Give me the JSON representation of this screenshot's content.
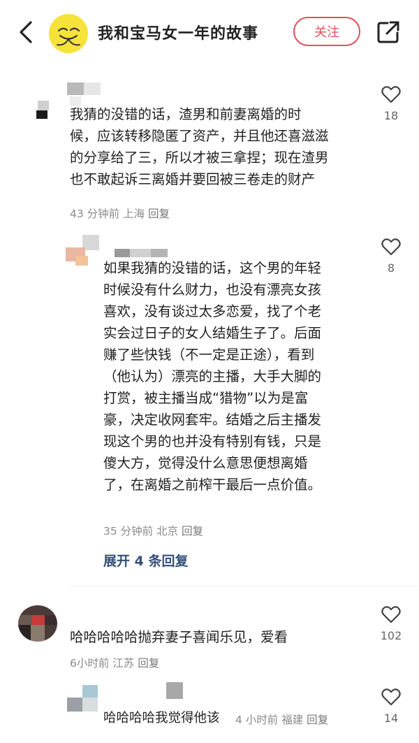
{
  "header": {
    "title": "我和宝马女一年的故事",
    "follow_label": "关注"
  },
  "comments": [
    {
      "lines": [
        "我猜的没错的话，渣男和前妻离婚的时",
        "候，应该转移隐匿了资产，并且他还喜滋滋",
        "的分享给了三，所以才被三拿捏；现在渣男",
        "也不敢起诉三离婚并要回被三卷走的财产"
      ],
      "meta": "43 分钟前 上海",
      "reply": "回复",
      "likes": "18"
    },
    {
      "lines": [
        "如果我猜的没错的话，这个男的年轻",
        "时候没有什么财力，也没有漂亮女孩",
        "喜欢，没有谈过太多恋爱，找了个老",
        "实会过日子的女人结婚生子了。后面",
        "赚了些快钱（不一定是正途），看到",
        "（他认为）漂亮的主播，大手大脚的",
        "打赏，被主播当成“猎物”以为是富",
        "豪，决定收网套牢。结婚之后主播发",
        "现这个男的也并没有特别有钱，只是",
        "傻大方，觉得没什么意思便想离婚",
        "了，在离婚之前榨干最后一点价值。"
      ],
      "meta": "35 分钟前 北京",
      "reply": "回复",
      "likes": "8",
      "expand": "展开 4 条回复"
    },
    {
      "text": "哈哈哈哈哈抛弃妻子喜闻乐见，爱看",
      "meta": "6小时前 江苏",
      "reply": "回复",
      "likes": "102"
    },
    {
      "text": "哈哈哈哈我觉得他该",
      "meta": "4 小时前 福建",
      "reply": "回复",
      "likes": "14"
    }
  ],
  "colors": {
    "accent": "#e0505a",
    "link": "#35507a",
    "avatar_yellow": "#f7e23a"
  },
  "icons": [
    "back-icon",
    "avatar-smiley",
    "share-icon",
    "heart-icon"
  ]
}
